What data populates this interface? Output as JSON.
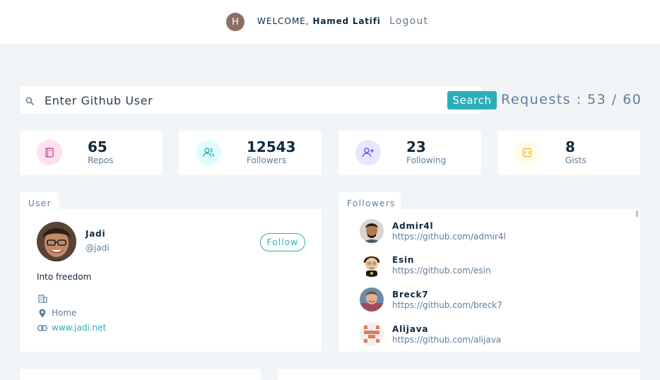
{
  "nav": {
    "avatar_letter": "H",
    "welcome_prefix": "WELCOME,",
    "user_name": "Hamed Latifi",
    "logout_label": "Logout"
  },
  "search": {
    "placeholder": "Enter Github User",
    "button_label": "Search",
    "requests_text": "Requests : 53 / 60"
  },
  "stats": [
    {
      "value": "65",
      "label": "Repos",
      "icon": "book-icon",
      "color": "#da4a91",
      "bg": "#ffe0f0"
    },
    {
      "value": "12543",
      "label": "Followers",
      "icon": "users-icon",
      "color": "#2caeba",
      "bg": "#e0fcff"
    },
    {
      "value": "23",
      "label": "Following",
      "icon": "user-plus-icon",
      "color": "#5d55fa",
      "bg": "#e6e6ff"
    },
    {
      "value": "8",
      "label": "Gists",
      "icon": "code-icon",
      "color": "#f0b429",
      "bg": "#fffbea"
    }
  ],
  "user_panel": {
    "tab_label": "User",
    "name": "Jadi",
    "handle": "@jadi",
    "follow_label": "Follow",
    "bio": "Into freedom",
    "company": "",
    "location": "Home",
    "blog": "www.jadi.net"
  },
  "followers_panel": {
    "tab_label": "Followers",
    "items": [
      {
        "login": "Admir4l",
        "url": "https://github.com/admir4l"
      },
      {
        "login": "Esin",
        "url": "https://github.com/esin"
      },
      {
        "login": "Breck7",
        "url": "https://github.com/breck7"
      },
      {
        "login": "Alijava",
        "url": "https://github.com/alijava"
      }
    ]
  }
}
